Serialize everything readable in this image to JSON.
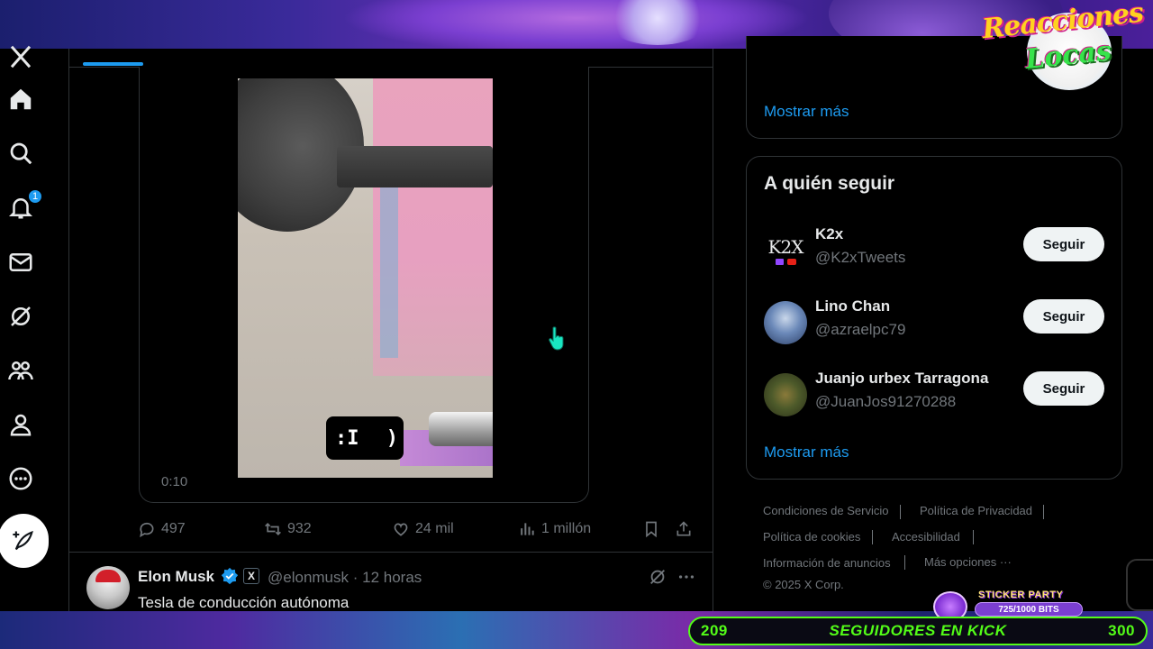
{
  "overlay": {
    "logo_line1": "Reacciones",
    "logo_line2": "Locas",
    "sticker_title": "STICKER PARTY",
    "sticker_bits": "725/1000 BITS",
    "kick_left": "209",
    "kick_label": "SEGUIDORES EN KICK",
    "kick_right": "300",
    "colors": {
      "kick_green": "#53fc18",
      "accent_purple": "#7b3fd1"
    }
  },
  "nav": {
    "notifications_badge": "1",
    "items": [
      "x-logo-icon",
      "home-icon",
      "search-icon",
      "bell-icon",
      "mail-icon",
      "grok-icon",
      "communities-icon",
      "profile-icon",
      "more-circle-icon",
      "post-icon"
    ]
  },
  "tweet1": {
    "video_time": "0:10",
    "video_face": ":I",
    "video_paren": ")",
    "actions": {
      "replies": "497",
      "reposts": "932",
      "likes": "24 mil",
      "views": "1 millón"
    }
  },
  "tweet2": {
    "name": "Elon Musk",
    "x_badge": "X",
    "handle": "@elonmusk · 12 horas",
    "text": "Tesla de conducción autónoma"
  },
  "right": {
    "show_more": "Mostrar más",
    "follow_title": "A quién seguir",
    "suggestions": [
      {
        "name": "K2x",
        "handle": "@K2xTweets",
        "avatar_text": "K2X",
        "button": "Seguir"
      },
      {
        "name": "Lino Chan",
        "handle": "@azraelpc79",
        "button": "Seguir"
      },
      {
        "name": "Juanjo urbex Tarragona",
        "handle": "@JuanJos91270288",
        "button": "Seguir"
      }
    ],
    "show_more_2": "Mostrar más",
    "footer": {
      "terms": "Condiciones de Servicio",
      "privacy": "Política de Privacidad",
      "cookies": "Política de cookies",
      "accessibility": "Accesibilidad",
      "ads_info": "Información de anuncios",
      "more_options": "Más opciones ···",
      "copyright": "© 2025 X Corp."
    }
  },
  "colors": {
    "accent": "#1d9bf0",
    "background": "#000000",
    "border": "#2f3336",
    "muted": "#71767b"
  }
}
